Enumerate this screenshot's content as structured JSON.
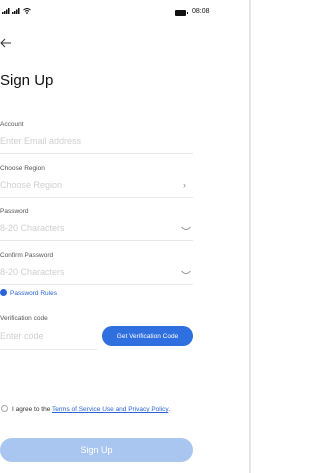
{
  "status_bar": {
    "signal": "ⁿ⁴ⁿ⁴",
    "time": "08:08"
  },
  "icons": {
    "back": "arrow-left-icon",
    "chevron": "chevron-right-icon",
    "eye": "eye-closed-icon",
    "info": "info-icon"
  },
  "title": "Sign Up",
  "fields": {
    "account": {
      "label": "Account",
      "placeholder": "Enter Email address"
    },
    "region": {
      "label": "Choose Region",
      "placeholder": "Choose Region",
      "chevron": "›"
    },
    "password": {
      "label": "Password",
      "placeholder": "8-20 Characters"
    },
    "confirm_password": {
      "label": "Confirm Password",
      "placeholder": "8-20 Characters"
    },
    "verification": {
      "label": "Verification code",
      "placeholder": "Enter code"
    }
  },
  "password_rules": "Password Rules",
  "verification_button": "Get Verification Code",
  "agreement": {
    "prefix": "I agree to the ",
    "link": "Terms of Service Use and Privacy Policy",
    "suffix": "."
  },
  "signup_button": "Sign Up",
  "colors": {
    "accent": "#2f6fdf",
    "link": "#2a64d8",
    "disabled_button": "#a9c6f1"
  }
}
